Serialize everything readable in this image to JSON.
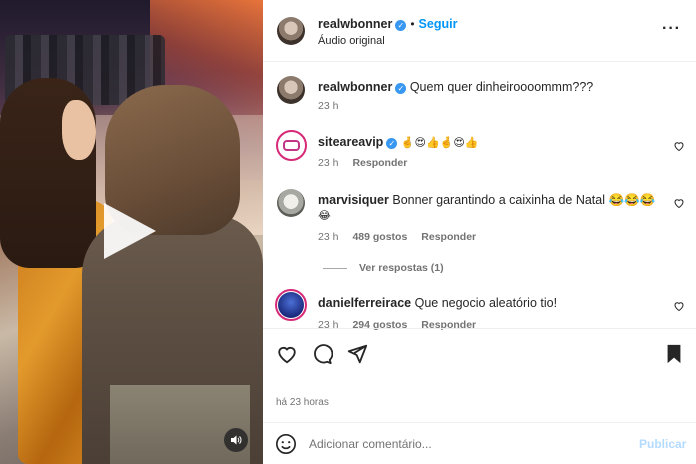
{
  "post": {
    "username": "realwbonner",
    "follow_label": "Seguir",
    "audio_label": "Áudio original",
    "caption": "Quem quer dinheiroooommm???",
    "caption_time": "23 h"
  },
  "comments": [
    {
      "username": "siteareavip",
      "text": "🤞😍👍🤞😍👍",
      "time": "23 h",
      "likes": "",
      "reply_label": "Responder"
    },
    {
      "username": "marvisiquer",
      "text": "Bonner garantindo a caixinha de Natal 😂😂😂",
      "text_wrap": "😂",
      "time": "23 h",
      "likes": "489 gostos",
      "reply_label": "Responder",
      "view_replies": "Ver respostas (1)"
    },
    {
      "username": "danielferreirace",
      "text": "Que negocio aleatório tio!",
      "time": "23 h",
      "likes": "294 gostos",
      "reply_label": "Responder"
    }
  ],
  "footer": {
    "time_ago": "há 23 horas",
    "comment_placeholder": "Adicionar comentário...",
    "publish_label": "Publicar"
  },
  "icons": {
    "like": "heart-icon",
    "comment": "comment-icon",
    "share": "share-icon",
    "save": "bookmark-icon",
    "emoji": "smiley-icon",
    "play": "play-icon",
    "sound": "speaker-icon",
    "more": "more-options-icon"
  },
  "colors": {
    "link_blue": "#0095f6",
    "verified_blue": "#3897f0",
    "publish_disabled": "#b3dbff",
    "muted_text": "#737373"
  }
}
